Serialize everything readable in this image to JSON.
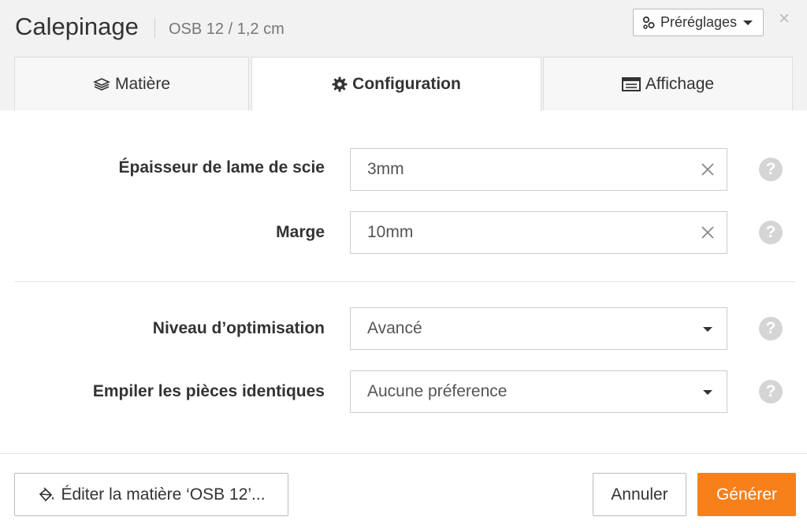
{
  "header": {
    "title": "Calepinage",
    "subtitle": "OSB 12 / 1,2 cm",
    "presets_label": "Préréglages",
    "close_label": "×"
  },
  "tabs": [
    {
      "label": "Matière",
      "icon": "layers-icon",
      "active": false
    },
    {
      "label": "Configuration",
      "icon": "gear-icon",
      "active": true
    },
    {
      "label": "Affichage",
      "icon": "display-icon",
      "active": false
    }
  ],
  "fields": {
    "blade_thickness": {
      "label": "Épaisseur de lame de scie",
      "value": "3mm"
    },
    "margin": {
      "label": "Marge",
      "value": "10mm"
    },
    "optimization_level": {
      "label": "Niveau d’optimisation",
      "value": "Avancé"
    },
    "stack_identical": {
      "label": "Empiler les pièces identiques",
      "value": "Aucune préference"
    }
  },
  "help_label": "?",
  "footer": {
    "edit_label": "Éditer la matière ‘OSB 12’...",
    "cancel_label": "Annuler",
    "generate_label": "Générer"
  },
  "colors": {
    "accent": "#f7801b",
    "header_bg": "#f2f2f2",
    "help_bg": "#d5d5d5"
  }
}
